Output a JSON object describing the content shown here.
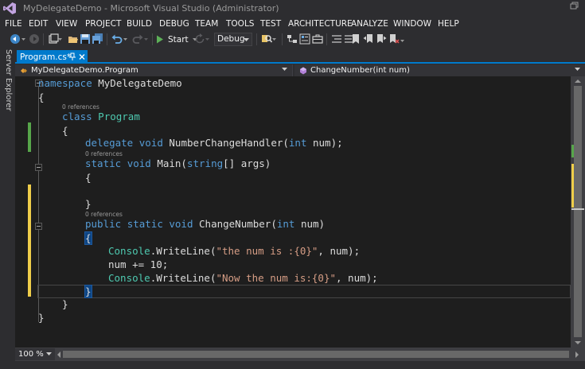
{
  "window": {
    "title": "MyDelegateDemo - Microsoft Visual Studio (Administrator)"
  },
  "menu": [
    "FILE",
    "EDIT",
    "VIEW",
    "PROJECT",
    "BUILD",
    "DEBUG",
    "TEAM",
    "TOOLS",
    "TEST",
    "ARCHITECTURE",
    "ANALYZE",
    "WINDOW",
    "HELP"
  ],
  "toolbar": {
    "start_label": "Start",
    "configuration": "Debug"
  },
  "side": {
    "server_explorer": "Server Explorer"
  },
  "tabs": [
    {
      "label": "Program.cs*",
      "active": true
    }
  ],
  "nav": {
    "class_scope": "MyDelegateDemo.Program",
    "member_scope": "ChangeNumber(int num)"
  },
  "codelens": {
    "references": "0 references"
  },
  "code": {
    "l1": {
      "kw": "namespace",
      "rest": " MyDelegateDemo"
    },
    "l2": "{",
    "l3": {
      "kw": "class",
      "type": "Program"
    },
    "l4": "{",
    "l5": {
      "kw1": "delegate",
      "kw2": "void",
      "name": "NumberChangeHandler(",
      "kw3": "int",
      "rest": " num);"
    },
    "l6": {
      "kw1": "static",
      "kw2": "void",
      "name": "Main(",
      "kw3": "string",
      "rest": "[] args)"
    },
    "l7": "{",
    "l8": "}",
    "l9": {
      "kw1": "public",
      "kw2": "static",
      "kw3": "void",
      "name": "ChangeNumber(",
      "kw4": "int",
      "rest": " num)"
    },
    "l10": "{",
    "l11": {
      "type": "Console",
      "call": ".WriteLine(",
      "str": "\"the num is :{0}\"",
      "rest": ", num);"
    },
    "l12": "num += 10;",
    "l13": {
      "type": "Console",
      "call": ".WriteLine(",
      "str": "\"Now the num is:{0}\"",
      "rest": ", num);"
    },
    "l14": "}",
    "l15": "}",
    "l16": "}"
  },
  "editor": {
    "zoom": "100 %"
  },
  "colors": {
    "accent": "#007acc",
    "keyword": "#569cd6",
    "type": "#4ec9b0",
    "string": "#d69d85",
    "saved_change": "#57a64a",
    "unsaved_change": "#efce4a"
  }
}
